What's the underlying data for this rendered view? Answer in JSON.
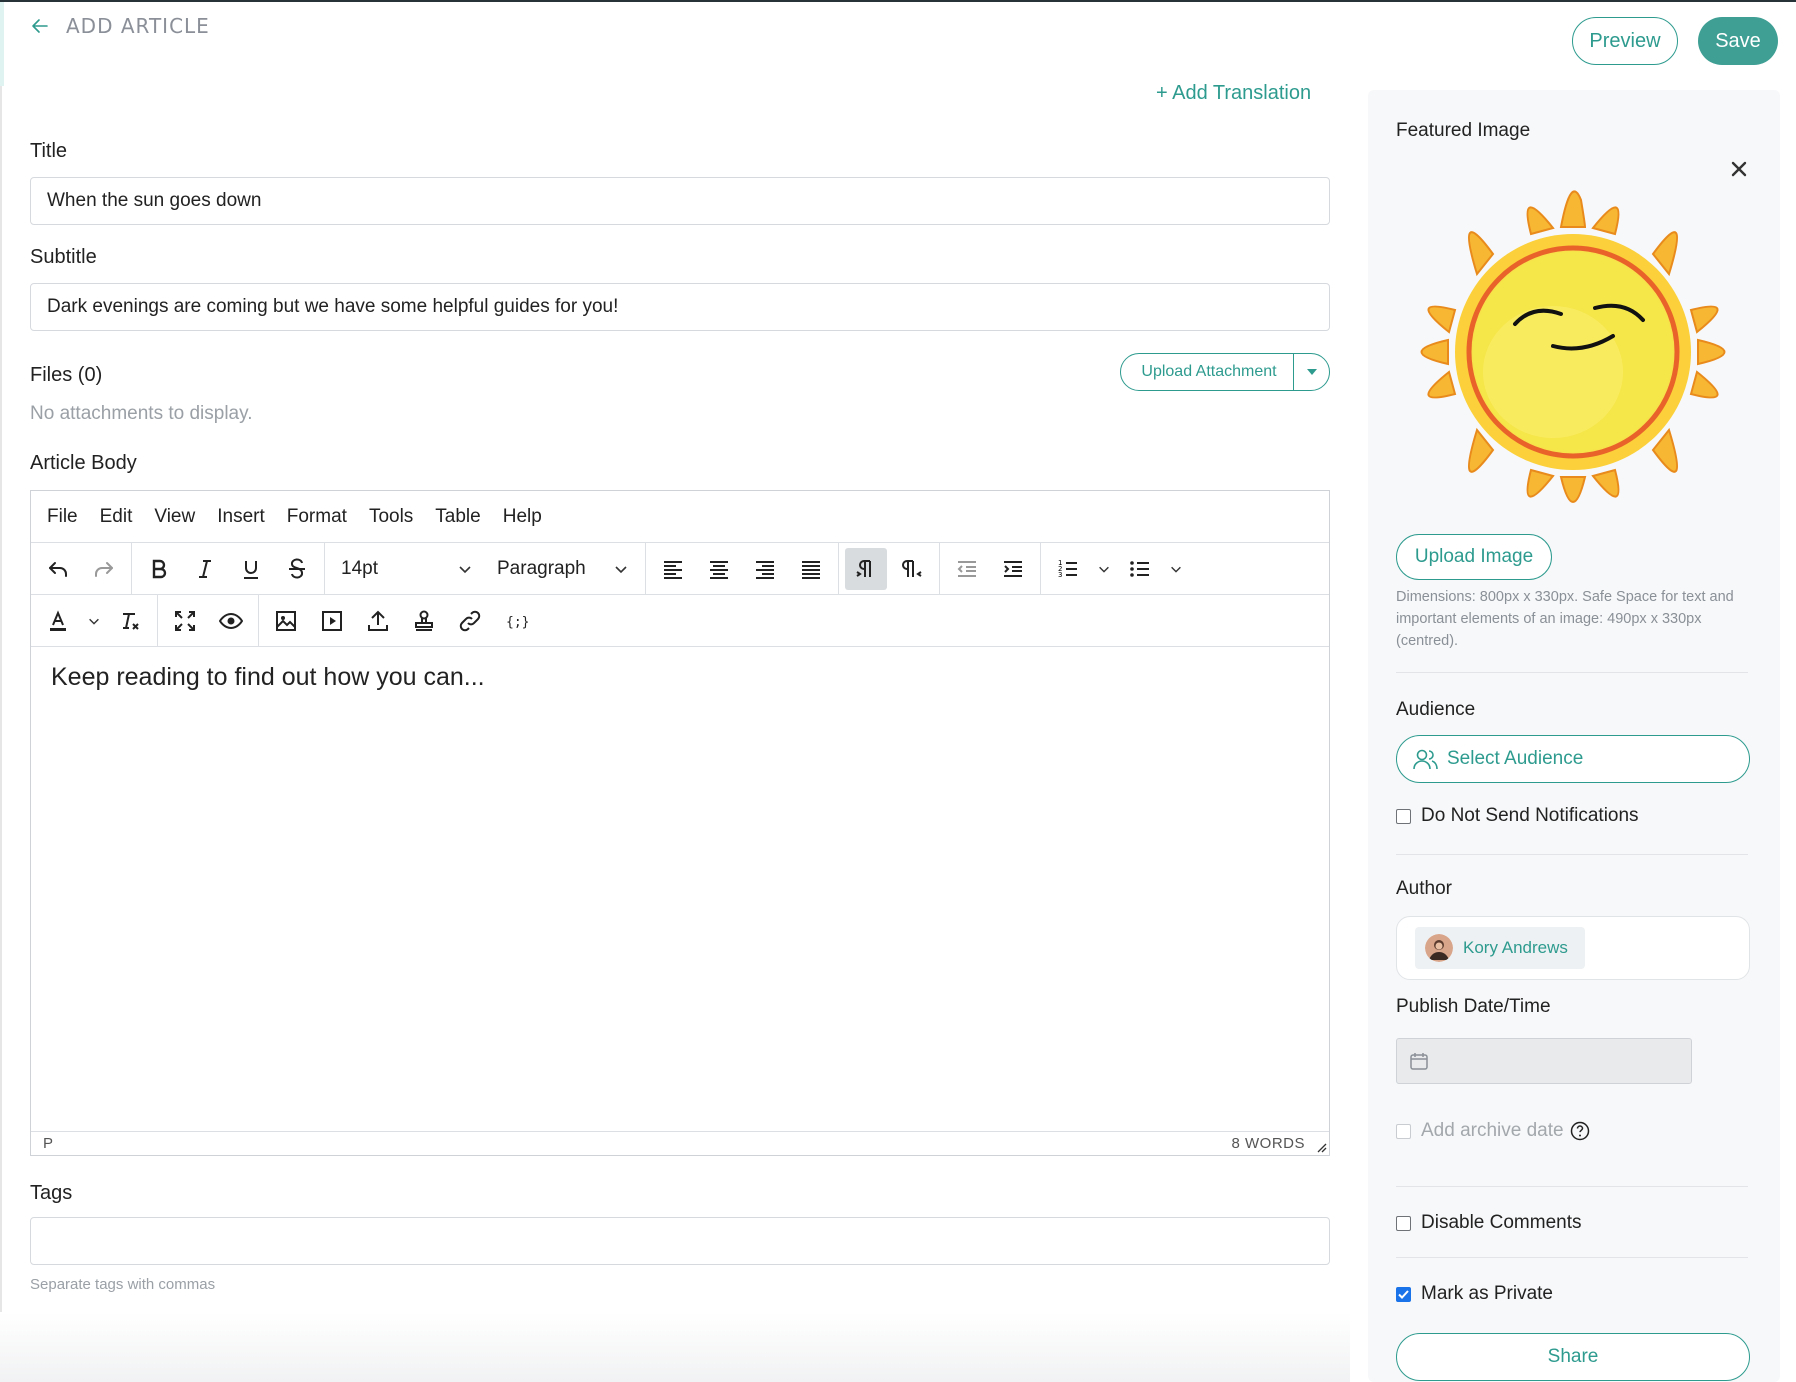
{
  "header": {
    "back_label": "ADD ARTICLE",
    "preview_label": "Preview",
    "save_label": "Save"
  },
  "main": {
    "add_translation": "+ Add Translation",
    "title_label": "Title",
    "title_value": "When the sun goes down",
    "subtitle_label": "Subtitle",
    "subtitle_value": "Dark evenings are coming but we have some helpful guides for you!",
    "files_label": "Files (0)",
    "no_attachments": "No attachments to display.",
    "upload_attachment": "Upload Attachment",
    "article_body_label": "Article Body",
    "tags_label": "Tags",
    "tags_value": "",
    "tags_hint": "Separate tags with commas"
  },
  "editor": {
    "menu": [
      "File",
      "Edit",
      "View",
      "Insert",
      "Format",
      "Tools",
      "Table",
      "Help"
    ],
    "font_size": "14pt",
    "block_format": "Paragraph",
    "content": "Keep reading to find out how you can...",
    "status_path": "P",
    "word_count": "8 WORDS",
    "toolbar_row1_icons": [
      "undo-icon",
      "redo-icon",
      "bold-icon",
      "italic-icon",
      "underline-icon",
      "strikethrough-icon",
      "align-left-icon",
      "align-center-icon",
      "align-right-icon",
      "align-justify-icon",
      "ltr-icon",
      "rtl-icon",
      "outdent-icon",
      "indent-icon",
      "numbered-list-icon",
      "bullet-list-icon"
    ],
    "toolbar_row2_icons": [
      "text-color-icon",
      "clear-format-icon",
      "fullscreen-icon",
      "preview-icon",
      "image-icon",
      "media-icon",
      "upload-icon",
      "stamp-icon",
      "link-icon",
      "code-variable-icon"
    ]
  },
  "sidebar": {
    "featured_image_label": "Featured Image",
    "upload_image": "Upload Image",
    "dimensions": "Dimensions: 800px x 330px. Safe Space for text and important elements of an image: 490px x 330px (centred).",
    "audience_label": "Audience",
    "select_audience": "Select Audience",
    "do_not_send": "Do Not Send Notifications",
    "author_label": "Author",
    "author_name": "Kory Andrews",
    "publish_label": "Publish Date/Time",
    "publish_value": "",
    "archive_label": "Add archive date",
    "disable_comments": "Disable Comments",
    "mark_private": "Mark as Private",
    "mark_private_checked": true,
    "share": "Share"
  },
  "colors": {
    "accent": "#2e9b8f",
    "save_bg": "#3f9f94",
    "checkbox_checked": "#1a73e8"
  }
}
